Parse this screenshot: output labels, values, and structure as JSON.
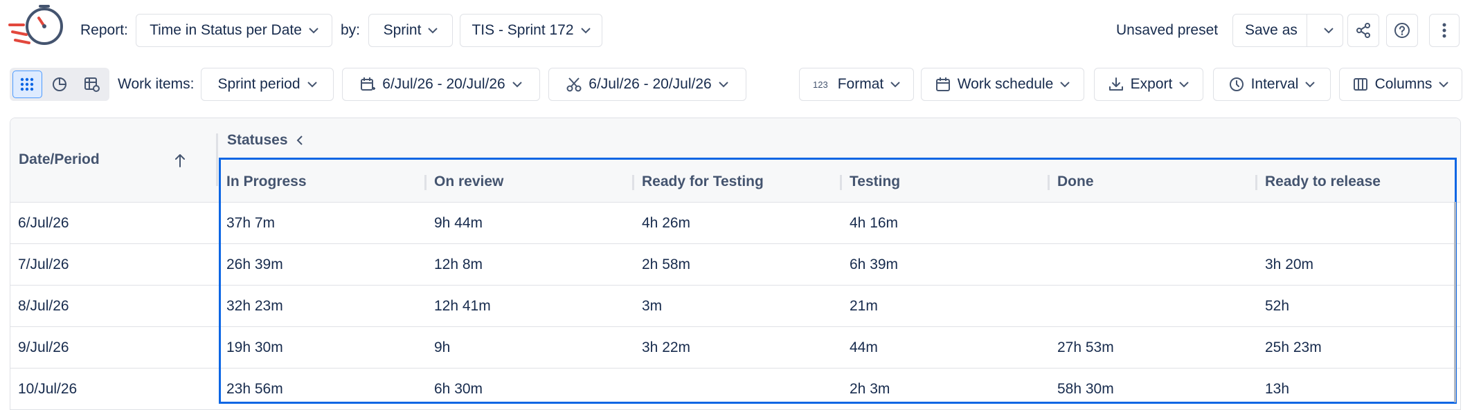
{
  "app": {
    "logo_icon": "stopwatch-logo-icon"
  },
  "header": {
    "report_label": "Report:",
    "report_value": "Time in Status per Date",
    "by_label": "by:",
    "group_value": "Sprint",
    "sprint_value": "TIS - Sprint 172",
    "preset_status": "Unsaved preset",
    "save_as_label": "Save as",
    "icons": [
      "share-icon",
      "help-icon",
      "more-vertical-icon"
    ]
  },
  "toolbar": {
    "view_modes": [
      "grid-view-icon",
      "pie-chart-icon",
      "table-settings-icon"
    ],
    "work_items_label": "Work items:",
    "period_value": "Sprint period",
    "date_range": "6/Jul/26 - 20/Jul/26",
    "cut_range": "6/Jul/26 - 20/Jul/26",
    "format_label": "Format",
    "work_schedule_label": "Work schedule",
    "export_label": "Export",
    "interval_label": "Interval",
    "columns_label": "Columns"
  },
  "table": {
    "date_header": "Date/Period",
    "group_header": "Statuses",
    "columns": [
      "In Progress",
      "On review",
      "Ready for Testing",
      "Testing",
      "Done",
      "Ready to release"
    ],
    "rows": [
      {
        "date": "6/Jul/26",
        "values": [
          "37h 7m",
          "9h 44m",
          "4h 26m",
          "4h 16m",
          "",
          ""
        ]
      },
      {
        "date": "7/Jul/26",
        "values": [
          "26h 39m",
          "12h 8m",
          "2h 58m",
          "6h 39m",
          "",
          "3h 20m"
        ]
      },
      {
        "date": "8/Jul/26",
        "values": [
          "32h 23m",
          "12h 41m",
          "3m",
          "21m",
          "",
          "52h"
        ]
      },
      {
        "date": "9/Jul/26",
        "values": [
          "19h 30m",
          "9h",
          "3h 22m",
          "44m",
          "27h 53m",
          "25h 23m"
        ]
      },
      {
        "date": "10/Jul/26",
        "values": [
          "23h 56m",
          "6h 30m",
          "",
          "2h 3m",
          "58h 30m",
          "13h"
        ]
      }
    ]
  },
  "colors": {
    "accent": "#0c66e4",
    "logo_red": "#e2483d",
    "logo_navy": "#44546f"
  }
}
